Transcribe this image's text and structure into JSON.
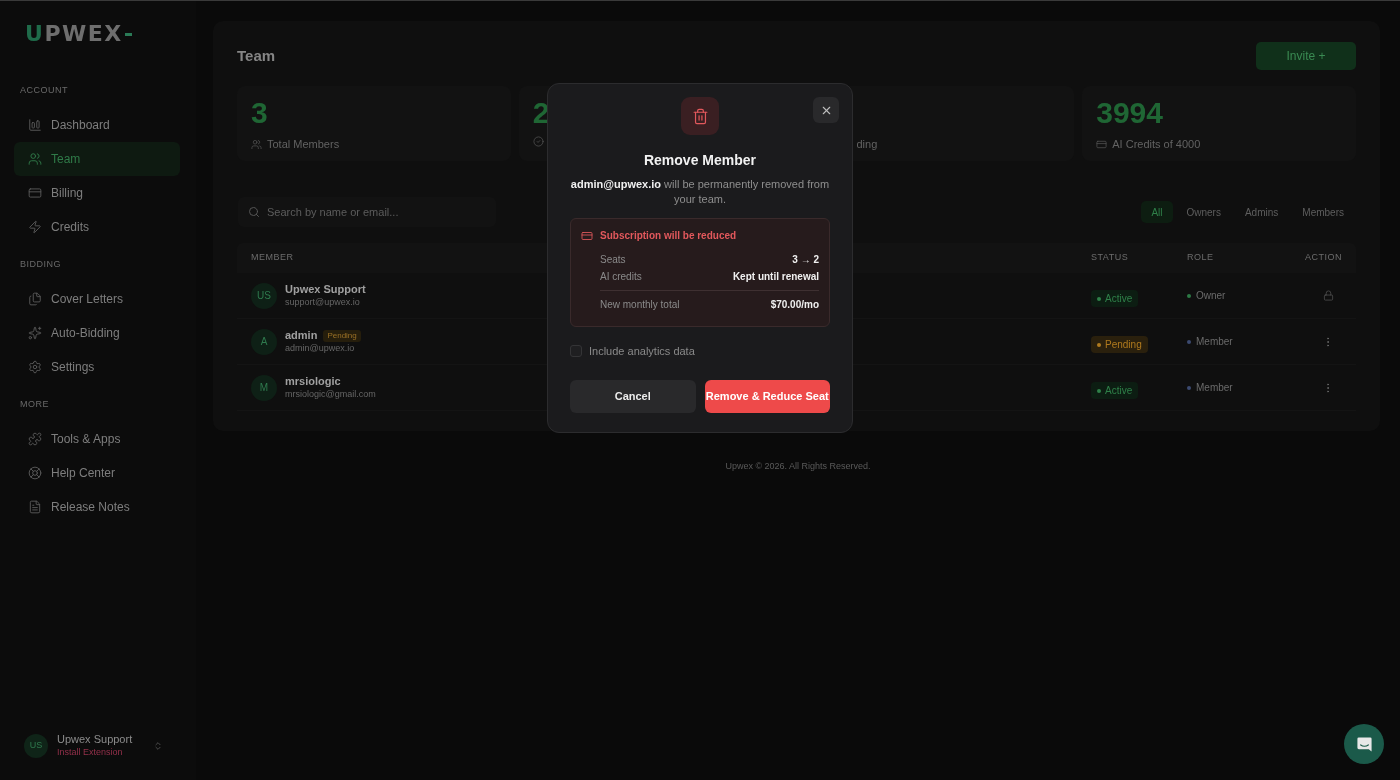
{
  "sidebar": {
    "logo": "UPWEX",
    "sections": [
      {
        "title": "ACCOUNT",
        "items": [
          {
            "label": "Dashboard",
            "selected": false
          },
          {
            "label": "Team",
            "selected": true
          },
          {
            "label": "Billing",
            "selected": false
          },
          {
            "label": "Credits",
            "selected": false
          }
        ]
      },
      {
        "title": "BIDDING",
        "items": [
          {
            "label": "Cover Letters",
            "selected": false
          },
          {
            "label": "Auto-Bidding",
            "selected": false
          },
          {
            "label": "Settings",
            "selected": false
          }
        ]
      },
      {
        "title": "MORE",
        "items": [
          {
            "label": "Tools & Apps",
            "selected": false
          },
          {
            "label": "Help Center",
            "selected": false
          },
          {
            "label": "Release Notes",
            "selected": false
          }
        ]
      }
    ],
    "user": {
      "initials": "US",
      "name": "Upwex Support",
      "link": "Install Extension"
    }
  },
  "page": {
    "title": "Team",
    "invite_button": "Invite +"
  },
  "stats": [
    {
      "value": "3",
      "label": "Total Members"
    },
    {
      "value": "2"
    },
    {
      "label": "ding"
    },
    {
      "value": "3994",
      "label": "AI Credits of 4000"
    }
  ],
  "search": {
    "placeholder": "Search by name or email..."
  },
  "filters": [
    {
      "label": "All",
      "selected": true
    },
    {
      "label": "Owners",
      "selected": false
    },
    {
      "label": "Admins",
      "selected": false
    },
    {
      "label": "Members",
      "selected": false
    }
  ],
  "table": {
    "columns": [
      "MEMBER",
      "STATUS",
      "ROLE",
      "ACTION"
    ],
    "rows": [
      {
        "initials": "US",
        "name": "Upwex Support",
        "email": "support@upwex.io",
        "status": {
          "label": "Active",
          "kind": "active"
        },
        "role": {
          "label": "Owner",
          "color": "#2c7a45"
        },
        "action": {
          "kind": "lock"
        }
      },
      {
        "initials": "A",
        "name": "admin",
        "tag": "Pending",
        "email": "admin@upwex.io",
        "status": {
          "label": "Pending",
          "kind": "pending"
        },
        "role": {
          "label": "Member",
          "color": "#3b4a70"
        },
        "action": {
          "kind": "menu"
        }
      },
      {
        "initials": "M",
        "name": "mrsiologic",
        "email": "mrsiologic@gmail.com",
        "status": {
          "label": "Active",
          "kind": "active"
        },
        "role": {
          "label": "Member",
          "color": "#3b4a70"
        },
        "action": {
          "kind": "menu"
        }
      }
    ]
  },
  "footer": "Upwex © 2026. All Rights Reserved.",
  "modal": {
    "title": "Remove Member",
    "message": "**admin@upwex.io** will be permanently removed from your team.",
    "notice": {
      "title": "Subscription will be reduced",
      "rows": [
        {
          "label": "Seats",
          "value": "3 → 2"
        },
        {
          "label": "AI credits",
          "value": "Kept until renewal"
        }
      ],
      "total": {
        "label": "New monthly total",
        "value": "$70.00/mo"
      }
    },
    "checkbox": {
      "label": "Include analytics data",
      "checked": false
    },
    "buttons": [
      {
        "label": "Cancel",
        "kind": "secondary"
      },
      {
        "label": "Remove & Reduce Seat",
        "kind": "danger"
      }
    ]
  }
}
